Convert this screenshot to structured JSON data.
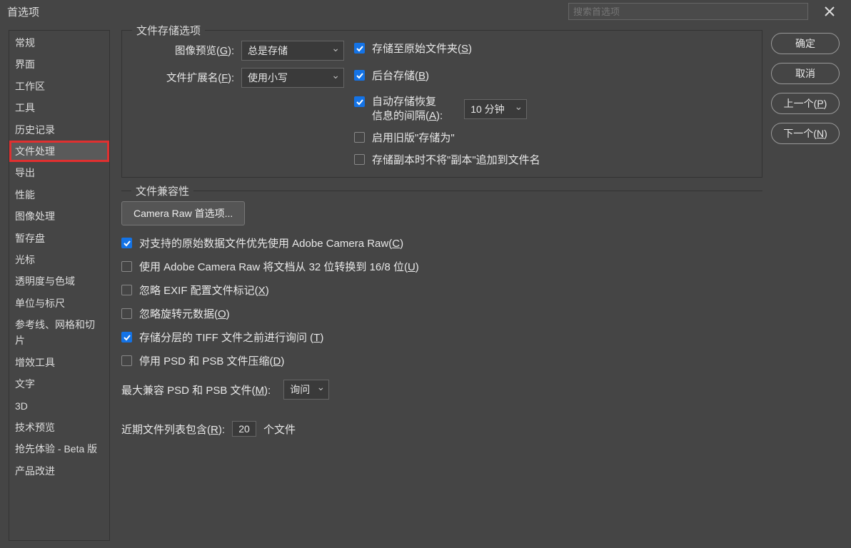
{
  "title": "首选项",
  "search_placeholder": "搜索首选项",
  "sidebar": {
    "items": [
      {
        "label": "常规"
      },
      {
        "label": "界面"
      },
      {
        "label": "工作区"
      },
      {
        "label": "工具"
      },
      {
        "label": "历史记录"
      },
      {
        "label": "文件处理",
        "selected": true
      },
      {
        "label": "导出"
      },
      {
        "label": "性能"
      },
      {
        "label": "图像处理"
      },
      {
        "label": "暂存盘"
      },
      {
        "label": "光标"
      },
      {
        "label": "透明度与色域"
      },
      {
        "label": "单位与标尺"
      },
      {
        "label": "参考线、网格和切片"
      },
      {
        "label": "增效工具"
      },
      {
        "label": "文字"
      },
      {
        "label": "3D"
      },
      {
        "label": "技术预览"
      },
      {
        "label": "抢先体验 - Beta 版"
      },
      {
        "label": "产品改进"
      }
    ]
  },
  "saving": {
    "legend": "文件存储选项",
    "image_preview_label_pre": "图像预览(",
    "image_preview_key": "G",
    "image_preview_label_post": "):",
    "image_preview_value": "总是存储",
    "file_ext_label_pre": "文件扩展名(",
    "file_ext_key": "F",
    "file_ext_label_post": "):",
    "file_ext_value": "使用小写",
    "save_original_pre": "存储至原始文件夹(",
    "save_original_key": "S",
    "save_original_post": ")",
    "bg_save_pre": "后台存储(",
    "bg_save_key": "B",
    "bg_save_post": ")",
    "auto_save_line1": "自动存储恢复",
    "auto_save_line2_pre": "信息的间隔(",
    "auto_save_key": "A",
    "auto_save_line2_post": "):",
    "auto_save_value": "10 分钟",
    "legacy_save": "启用旧版\"存储为\"",
    "no_copy_suffix": "存储副本时不将\"副本\"追加到文件名"
  },
  "compat": {
    "legend": "文件兼容性",
    "camera_raw_btn": "Camera Raw 首选项...",
    "prefer_acr_pre": "对支持的原始数据文件优先使用 Adobe Camera Raw(",
    "prefer_acr_key": "C",
    "prefer_acr_post": ")",
    "acr_32_pre": "使用 Adobe Camera Raw 将文档从 32 位转换到 16/8 位(",
    "acr_32_key": "U",
    "acr_32_post": ")",
    "ignore_exif_pre": "忽略 EXIF 配置文件标记(",
    "ignore_exif_key": "X",
    "ignore_exif_post": ")",
    "ignore_rot_pre": "忽略旋转元数据(",
    "ignore_rot_key": "O",
    "ignore_rot_post": ")",
    "tiff_ask_pre": "存储分层的 TIFF 文件之前进行询问   (",
    "tiff_ask_key": "T",
    "tiff_ask_post": ")",
    "disable_psd_pre": "停用 PSD 和 PSB 文件压缩(",
    "disable_psd_key": "D",
    "disable_psd_post": ")",
    "max_psd_label_pre": "最大兼容 PSD 和 PSB 文件(",
    "max_psd_key": "M",
    "max_psd_label_post": "):",
    "max_psd_value": "询问"
  },
  "recent": {
    "label_pre": "近期文件列表包含(",
    "label_key": "R",
    "label_post": "):",
    "value": "20",
    "suffix": "个文件"
  },
  "buttons": {
    "ok": "确定",
    "cancel": "取消",
    "prev_pre": "上一个(",
    "prev_key": "P",
    "prev_post": ")",
    "next_pre": "下一个(",
    "next_key": "N",
    "next_post": ")"
  }
}
